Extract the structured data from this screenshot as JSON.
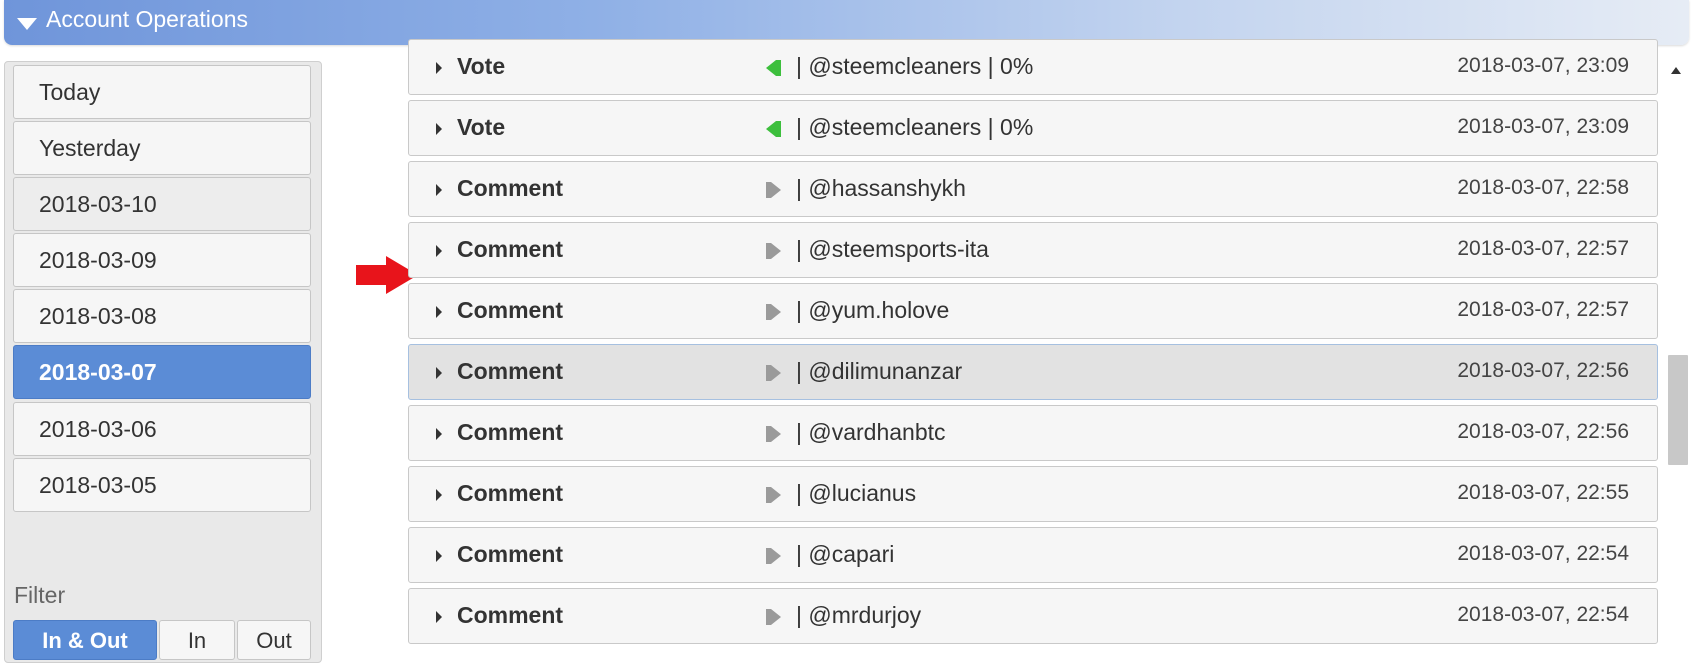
{
  "header": {
    "title": "Account Operations"
  },
  "sidebar": {
    "dates": [
      {
        "label": "Today"
      },
      {
        "label": "Yesterday"
      },
      {
        "label": "2018-03-10"
      },
      {
        "label": "2018-03-09"
      },
      {
        "label": "2018-03-08"
      },
      {
        "label": "2018-03-07",
        "active": true
      },
      {
        "label": "2018-03-06"
      },
      {
        "label": "2018-03-05"
      }
    ],
    "filter_label": "Filter",
    "filters": [
      {
        "label": "In & Out",
        "active": true
      },
      {
        "label": "In"
      },
      {
        "label": "Out"
      }
    ]
  },
  "operations": [
    {
      "type": "Vote",
      "direction": "in-green",
      "target": "| @steemcleaners | 0%",
      "time": "2018-03-07, 23:09"
    },
    {
      "type": "Vote",
      "direction": "in-green",
      "target": "| @steemcleaners | 0%",
      "time": "2018-03-07, 23:09"
    },
    {
      "type": "Comment",
      "direction": "out-gray",
      "target": "| @hassanshykh",
      "time": "2018-03-07, 22:58"
    },
    {
      "type": "Comment",
      "direction": "out-gray",
      "target": "| @steemsports-ita",
      "time": "2018-03-07, 22:57"
    },
    {
      "type": "Comment",
      "direction": "out-gray",
      "target": "| @yum.holove",
      "time": "2018-03-07, 22:57"
    },
    {
      "type": "Comment",
      "direction": "out-gray",
      "target": "| @dilimunanzar",
      "time": "2018-03-07, 22:56",
      "highlighted": true
    },
    {
      "type": "Comment",
      "direction": "out-gray",
      "target": "| @vardhanbtc",
      "time": "2018-03-07, 22:56"
    },
    {
      "type": "Comment",
      "direction": "out-gray",
      "target": "| @lucianus",
      "time": "2018-03-07, 22:55"
    },
    {
      "type": "Comment",
      "direction": "out-gray",
      "target": "| @capari",
      "time": "2018-03-07, 22:54"
    },
    {
      "type": "Comment",
      "direction": "out-gray",
      "target": "| @mrdurjoy",
      "time": "2018-03-07, 22:54"
    }
  ],
  "colors": {
    "accent": "#5b8cd6",
    "vote_in": "#3dbf3d",
    "comment_out": "#9a9a9a",
    "arrow": "#e8141b"
  }
}
